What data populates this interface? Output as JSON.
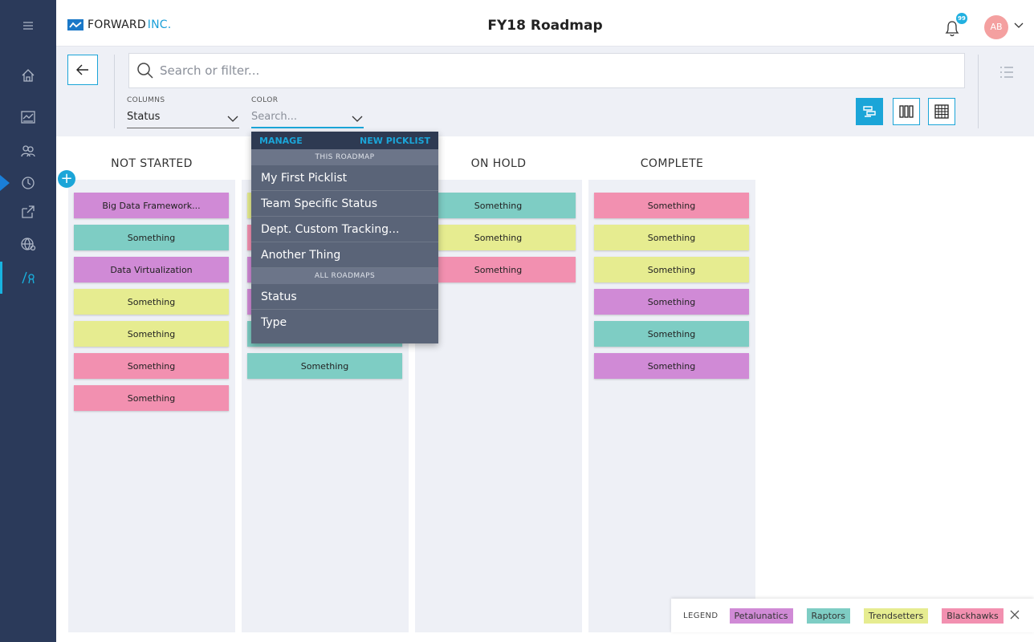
{
  "app": {
    "logo_main": "FORWARD",
    "logo_sub": "INC.",
    "title": "FY18 Roadmap",
    "notification_count": "99",
    "user_initials": "AB"
  },
  "nav": {
    "items": [
      "menu-icon",
      "home-icon",
      "chart-icon",
      "people-icon",
      "clock-icon",
      "export-icon",
      "globe-icon",
      "roadmap-icon"
    ],
    "active": "roadmap-icon"
  },
  "toolbar": {
    "search_placeholder": "Search or filter...",
    "columns_label": "COLUMNS",
    "columns_value": "Status",
    "color_label": "COLOR",
    "color_placeholder": "Search...",
    "views": [
      "timeline-view-icon",
      "columns-view-icon",
      "grid-view-icon"
    ],
    "active_view": "timeline-view-icon"
  },
  "dropdown": {
    "manage": "MANAGE",
    "new_picklist": "NEW PICKLIST",
    "section_this": "THIS ROADMAP",
    "this_items": [
      "My First Picklist",
      "Team Specific Status",
      "Dept. Custom Tracking...",
      "Another Thing"
    ],
    "section_all": "ALL ROADMAPS",
    "all_items": [
      "Status",
      "Type"
    ]
  },
  "board": {
    "columns": [
      {
        "title": "NOT STARTED",
        "cards": [
          {
            "label": "Big Data Framework...",
            "color": "#d08ad6"
          },
          {
            "label": "Something",
            "color": "#7ecdc4"
          },
          {
            "label": "Data Virtualization",
            "color": "#d08ad6"
          },
          {
            "label": "Something",
            "color": "#e6ec90"
          },
          {
            "label": "Something",
            "color": "#e6ec90"
          },
          {
            "label": "Something",
            "color": "#f290b0"
          },
          {
            "label": "Something",
            "color": "#f290b0"
          }
        ]
      },
      {
        "title": "",
        "cards": [
          {
            "label": "",
            "color": "#e6ec90"
          },
          {
            "label": "",
            "color": "#f290b0"
          },
          {
            "label": "",
            "color": "#d08ad6"
          },
          {
            "label": "",
            "color": "#d08ad6"
          },
          {
            "label": "",
            "color": "#7ecdc4"
          },
          {
            "label": "Something",
            "color": "#7ecdc4"
          }
        ]
      },
      {
        "title": "ON HOLD",
        "cards": [
          {
            "label": "Something",
            "color": "#7ecdc4"
          },
          {
            "label": "Something",
            "color": "#e6ec90"
          },
          {
            "label": "Something",
            "color": "#f290b0"
          }
        ]
      },
      {
        "title": "COMPLETE",
        "cards": [
          {
            "label": "Something",
            "color": "#f290b0"
          },
          {
            "label": "Something",
            "color": "#e6ec90"
          },
          {
            "label": "Something",
            "color": "#e6ec90"
          },
          {
            "label": "Something",
            "color": "#d08ad6"
          },
          {
            "label": "Something",
            "color": "#7ecdc4"
          },
          {
            "label": "Something",
            "color": "#d08ad6"
          }
        ]
      }
    ]
  },
  "legend": {
    "label": "LEGEND",
    "items": [
      {
        "name": "Petalunatics",
        "color": "#d08ad6"
      },
      {
        "name": "Raptors",
        "color": "#7ecdc4"
      },
      {
        "name": "Trendsetters",
        "color": "#e6ec90"
      },
      {
        "name": "Blackhawks",
        "color": "#f290b0"
      }
    ]
  },
  "colors": {
    "accent": "#1ba5d8",
    "nav_bg": "#2b3a5a",
    "board_bg": "#eef0f6"
  }
}
